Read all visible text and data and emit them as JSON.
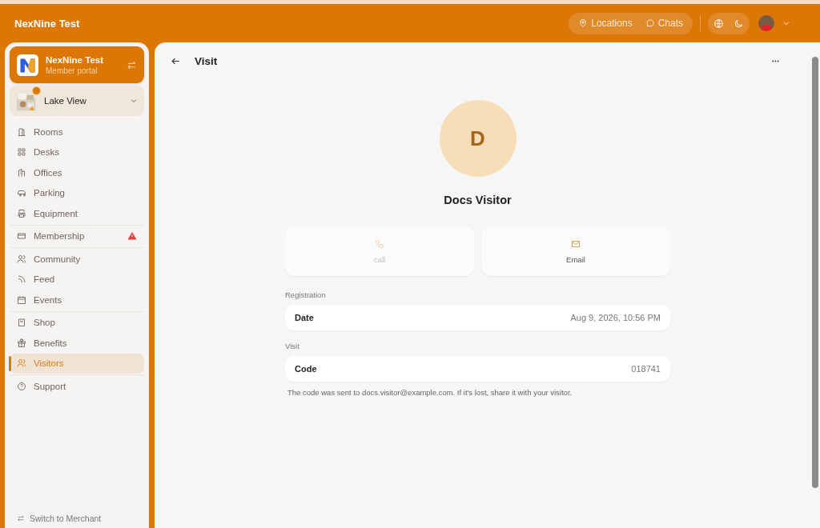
{
  "header": {
    "title": "NexNine Test",
    "links": [
      {
        "label": "Locations"
      },
      {
        "label": "Chats"
      }
    ]
  },
  "sidebar": {
    "org": {
      "name": "NexNine Test",
      "subtitle": "Member portal"
    },
    "location": {
      "name": "Lake View",
      "notice": true
    },
    "nav_groups": [
      {
        "items": [
          {
            "label": "Rooms",
            "selected": false,
            "warning": false
          },
          {
            "label": "Desks",
            "selected": false,
            "warning": false
          },
          {
            "label": "Offices",
            "selected": false,
            "warning": false
          },
          {
            "label": "Parking",
            "selected": false,
            "warning": false
          },
          {
            "label": "Equipment",
            "selected": false,
            "warning": false
          }
        ]
      },
      {
        "items": [
          {
            "label": "Membership",
            "selected": false,
            "warning": true
          }
        ]
      },
      {
        "items": [
          {
            "label": "Community",
            "selected": false,
            "warning": false
          },
          {
            "label": "Feed",
            "selected": false,
            "warning": false
          },
          {
            "label": "Events",
            "selected": false,
            "warning": false
          }
        ]
      },
      {
        "items": [
          {
            "label": "Shop",
            "selected": false,
            "warning": false
          },
          {
            "label": "Benefits",
            "selected": false,
            "warning": false
          },
          {
            "label": "Visitors",
            "selected": true,
            "warning": false
          }
        ]
      },
      {
        "items": [
          {
            "label": "Support",
            "selected": false,
            "warning": false
          }
        ]
      }
    ],
    "footer": "Switch to Merchant"
  },
  "page": {
    "title": "Visit",
    "visitor": {
      "initial": "D",
      "name": "Docs Visitor"
    },
    "actions": [
      {
        "label": "call",
        "disabled": true
      },
      {
        "label": "Email",
        "disabled": false
      }
    ],
    "sections": [
      {
        "heading": "Registration",
        "label": "Date",
        "value": "Aug 9, 2026, 10:56 PM"
      },
      {
        "heading": "Visit",
        "label": "Code",
        "value": "018741"
      }
    ],
    "note": "The code was sent to docs.visitor@example.com. If it's lost, share it with your visitor."
  }
}
